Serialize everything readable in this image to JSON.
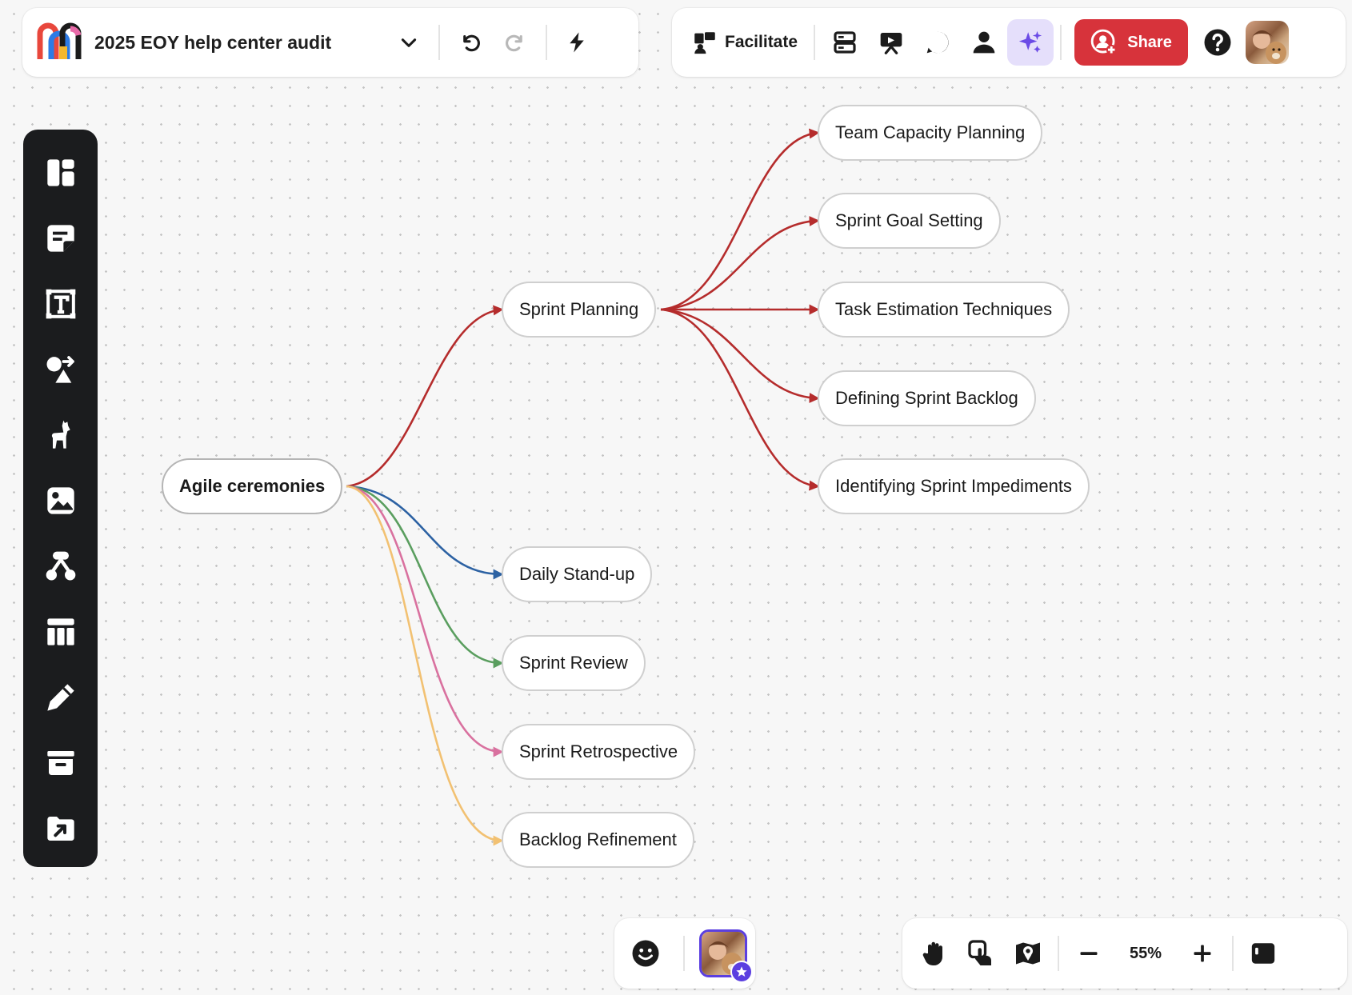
{
  "app": {
    "doc_title": "2025 EOY help center audit",
    "logo_icon": "mural-logo-icon"
  },
  "toolbar": {
    "facilitate_label": "Facilitate",
    "share_label": "Share",
    "icons": [
      "chevron-down-icon",
      "undo-icon",
      "redo-icon",
      "lightning-icon",
      "outline-icon",
      "present-icon",
      "comment-icon",
      "user-icon",
      "ai-sparkle-icon",
      "help-icon"
    ]
  },
  "sidebar": {
    "items": [
      "templates-icon",
      "sticky-note-icon",
      "text-icon",
      "shapes-icon",
      "llama-icon",
      "image-icon",
      "diagram-icon",
      "table-icon",
      "pen-icon",
      "archive-icon",
      "upload-folder-icon"
    ]
  },
  "mindmap": {
    "root": "Agile ceremonies",
    "nodes": {
      "sprint_planning": "Sprint Planning",
      "team_capacity": "Team Capacity Planning",
      "sprint_goal": "Sprint Goal Setting",
      "task_estimation": "Task Estimation Techniques",
      "defining_backlog": "Defining Sprint Backlog",
      "identifying_impediments": "Identifying Sprint Impediments",
      "daily_standup": "Daily Stand-up",
      "sprint_review": "Sprint Review",
      "sprint_retro": "Sprint Retrospective",
      "backlog_refinement": "Backlog Refinement"
    },
    "branch_colors": {
      "sprint_planning": "#b52c2c",
      "daily_standup": "#2d62a3",
      "sprint_review": "#5a9e5f",
      "sprint_retro": "#d9719f",
      "backlog_refinement": "#f2c172"
    }
  },
  "bottom": {
    "zoom": "55%",
    "icons": [
      "emoji-icon",
      "hand-icon",
      "touch-icon",
      "map-pin-icon",
      "minus-icon",
      "plus-icon",
      "panel-icon"
    ]
  },
  "colors": {
    "share": "#d7333b",
    "ai_bg": "#e5dffb",
    "ai": "#6b4be6",
    "sidebar_bg": "#1b1c1e"
  }
}
